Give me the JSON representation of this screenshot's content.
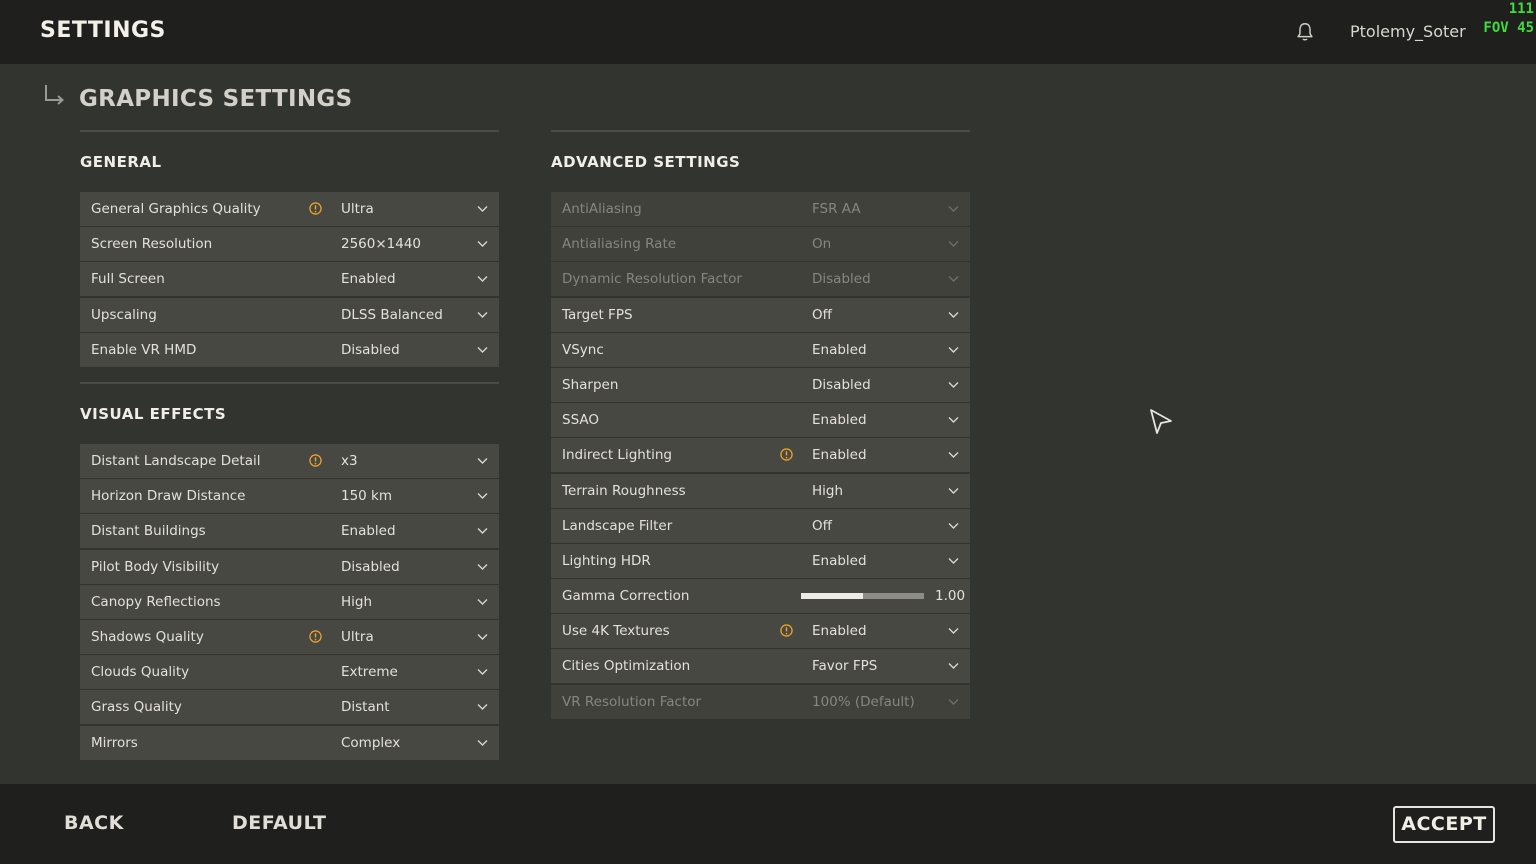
{
  "header": {
    "title": "SETTINGS",
    "username": "Ptolemy_Soter",
    "debug_line1": "111",
    "debug_line2": "FOV 45"
  },
  "page": {
    "title": "GRAPHICS SETTINGS"
  },
  "general": {
    "title": "GENERAL",
    "rows": [
      {
        "label": "General Graphics Quality",
        "value": "Ultra",
        "warning": true
      },
      {
        "label": "Screen Resolution",
        "value": "2560×1440"
      },
      {
        "label": "Full Screen",
        "value": "Enabled"
      },
      {
        "label": "Upscaling",
        "value": "DLSS Balanced"
      },
      {
        "label": "Enable VR HMD",
        "value": "Disabled"
      }
    ]
  },
  "visual": {
    "title": "VISUAL EFFECTS",
    "rows": [
      {
        "label": "Distant Landscape Detail",
        "value": "x3",
        "warning": true
      },
      {
        "label": "Horizon Draw Distance",
        "value": "150 km"
      },
      {
        "label": "Distant Buildings",
        "value": "Enabled"
      },
      {
        "label": "Pilot Body Visibility",
        "value": "Disabled"
      },
      {
        "label": "Canopy Reflections",
        "value": "High"
      },
      {
        "label": "Shadows Quality",
        "value": "Ultra",
        "warning": true
      },
      {
        "label": "Clouds Quality",
        "value": "Extreme"
      },
      {
        "label": "Grass Quality",
        "value": "Distant"
      },
      {
        "label": "Mirrors",
        "value": "Complex"
      }
    ]
  },
  "advanced": {
    "title": "ADVANCED SETTINGS",
    "rows": [
      {
        "label": "AntiAliasing",
        "value": "FSR AA",
        "disabled": true
      },
      {
        "label": "Antialiasing Rate",
        "value": "On",
        "disabled": true
      },
      {
        "label": "Dynamic Resolution Factor",
        "value": "Disabled",
        "disabled": true
      },
      {
        "label": "Target FPS",
        "value": "Off"
      },
      {
        "label": "VSync",
        "value": "Enabled"
      },
      {
        "label": "Sharpen",
        "value": "Disabled"
      },
      {
        "label": "SSAO",
        "value": "Enabled"
      },
      {
        "label": "Indirect Lighting",
        "value": "Enabled",
        "warning": true
      },
      {
        "label": "Terrain Roughness",
        "value": "High"
      },
      {
        "label": "Landscape Filter",
        "value": "Off"
      },
      {
        "label": "Lighting HDR",
        "value": "Enabled"
      },
      {
        "label": "Gamma Correction",
        "value": "1.00",
        "slider": 0.5
      },
      {
        "label": "Use 4K Textures",
        "value": "Enabled",
        "warning": true
      },
      {
        "label": "Cities Optimization",
        "value": "Favor FPS"
      },
      {
        "label": "VR Resolution Factor",
        "value": "100% (Default)",
        "disabled": true
      }
    ]
  },
  "footer": {
    "back_label": "BACK",
    "default_label": "DEFAULT",
    "accept_label": "ACCEPT"
  },
  "colors": {
    "warning": "#e8a030",
    "background": "#32342f",
    "row": "#474841",
    "debug_text": "#3fdc3a"
  }
}
